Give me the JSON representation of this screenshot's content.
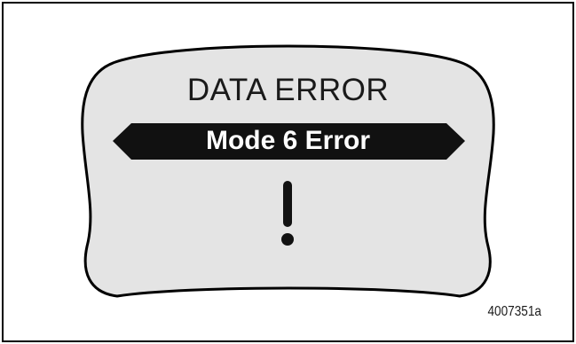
{
  "display": {
    "title": "DATA ERROR",
    "message": "Mode 6 Error",
    "alert_icon": "exclamation-icon",
    "screen_color": "#e4e4e4",
    "banner_color": "#111111"
  },
  "figure": {
    "reference_code": "4007351a"
  }
}
